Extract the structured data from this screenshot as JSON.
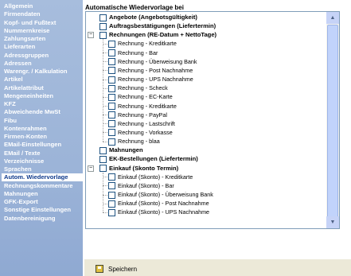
{
  "sidebar": {
    "items": [
      {
        "label": "Allgemein",
        "active": false
      },
      {
        "label": "Firmendaten",
        "active": false
      },
      {
        "label": "Kopf- und Fußtext",
        "active": false
      },
      {
        "label": "Nummernkreise",
        "active": false
      },
      {
        "label": "Zahlungsarten",
        "active": false
      },
      {
        "label": "Lieferarten",
        "active": false
      },
      {
        "label": "Adressgruppen",
        "active": false
      },
      {
        "label": "Adressen",
        "active": false
      },
      {
        "label": "Warengr. / Kalkulation",
        "active": false
      },
      {
        "label": "Artikel",
        "active": false
      },
      {
        "label": "Artikelattribut",
        "active": false
      },
      {
        "label": "Mengeneinheiten",
        "active": false
      },
      {
        "label": "KFZ",
        "active": false
      },
      {
        "label": "Abweichende MwSt",
        "active": false
      },
      {
        "label": "Fibu",
        "active": false
      },
      {
        "label": "Kontenrahmen",
        "active": false
      },
      {
        "label": "Firmen-Konten",
        "active": false
      },
      {
        "label": "EMail-Einstellungen",
        "active": false
      },
      {
        "label": "EMail / Texte",
        "active": false
      },
      {
        "label": "Verzeichnisse",
        "active": false
      },
      {
        "label": "Sprachen",
        "active": false
      },
      {
        "label": "Autom. Wiedervorlage",
        "active": true
      },
      {
        "label": "Rechnungskommentare",
        "active": false
      },
      {
        "label": "Mahnungen",
        "active": false
      },
      {
        "label": "GFK-Export",
        "active": false
      },
      {
        "label": "Sonstige Einstellungen",
        "active": false
      },
      {
        "label": "Datenbereinigung",
        "active": false
      }
    ]
  },
  "main": {
    "heading": "Automatische Wiedervorlage bei",
    "tree": [
      {
        "label": "Angebote (Angebotsgültigkeit)",
        "level": 0,
        "bold": true,
        "expander": false
      },
      {
        "label": "Auftragsbestätigungen (Liefertermin)",
        "level": 0,
        "bold": true,
        "expander": false
      },
      {
        "label": "Rechnungen (RE-Datum + NettoTage)",
        "level": 0,
        "bold": true,
        "expander": true
      },
      {
        "label": "Rechnung - Kreditkarte",
        "level": 1,
        "bold": false
      },
      {
        "label": "Rechnung - Bar",
        "level": 1,
        "bold": false
      },
      {
        "label": "Rechnung - Überweisung Bank",
        "level": 1,
        "bold": false
      },
      {
        "label": "Rechnung - Post Nachnahme",
        "level": 1,
        "bold": false
      },
      {
        "label": "Rechnung - UPS Nachnahme",
        "level": 1,
        "bold": false
      },
      {
        "label": "Rechnung - Scheck",
        "level": 1,
        "bold": false
      },
      {
        "label": "Rechnung - EC-Karte",
        "level": 1,
        "bold": false
      },
      {
        "label": "Rechnung - Kreditkarte",
        "level": 1,
        "bold": false
      },
      {
        "label": "Rechnung - PayPal",
        "level": 1,
        "bold": false
      },
      {
        "label": "Rechnung - Lastschrift",
        "level": 1,
        "bold": false
      },
      {
        "label": "Rechnung - Vorkasse",
        "level": 1,
        "bold": false
      },
      {
        "label": "Rechnung - blaa",
        "level": 1,
        "bold": false
      },
      {
        "label": "Mahnungen",
        "level": 0,
        "bold": true,
        "expander": false
      },
      {
        "label": "EK-Bestellungen (Liefertermin)",
        "level": 0,
        "bold": true,
        "expander": false
      },
      {
        "label": "Einkauf (Skonto Termin)",
        "level": 0,
        "bold": true,
        "expander": true
      },
      {
        "label": "Einkauf (Skonto) - Kreditkarte",
        "level": 1,
        "bold": false
      },
      {
        "label": "Einkauf (Skonto) - Bar",
        "level": 1,
        "bold": false
      },
      {
        "label": "Einkauf (Skonto) - Überweisung Bank",
        "level": 1,
        "bold": false
      },
      {
        "label": "Einkauf (Skonto) - Post Nachnahme",
        "level": 1,
        "bold": false
      },
      {
        "label": "Einkauf (Skonto) - UPS Nachnahme",
        "level": 1,
        "bold": false
      }
    ],
    "expander_symbol": "−"
  },
  "footer": {
    "save_label": "Speichern",
    "save_icon": "floppy-disk-icon"
  },
  "scrollbar": {
    "up_symbol": "▲",
    "down_symbol": "▼"
  },
  "colors": {
    "sidebar": "#9cb4d8",
    "active_text": "#0f3a8c",
    "checkbox_border": "#1c5180"
  }
}
